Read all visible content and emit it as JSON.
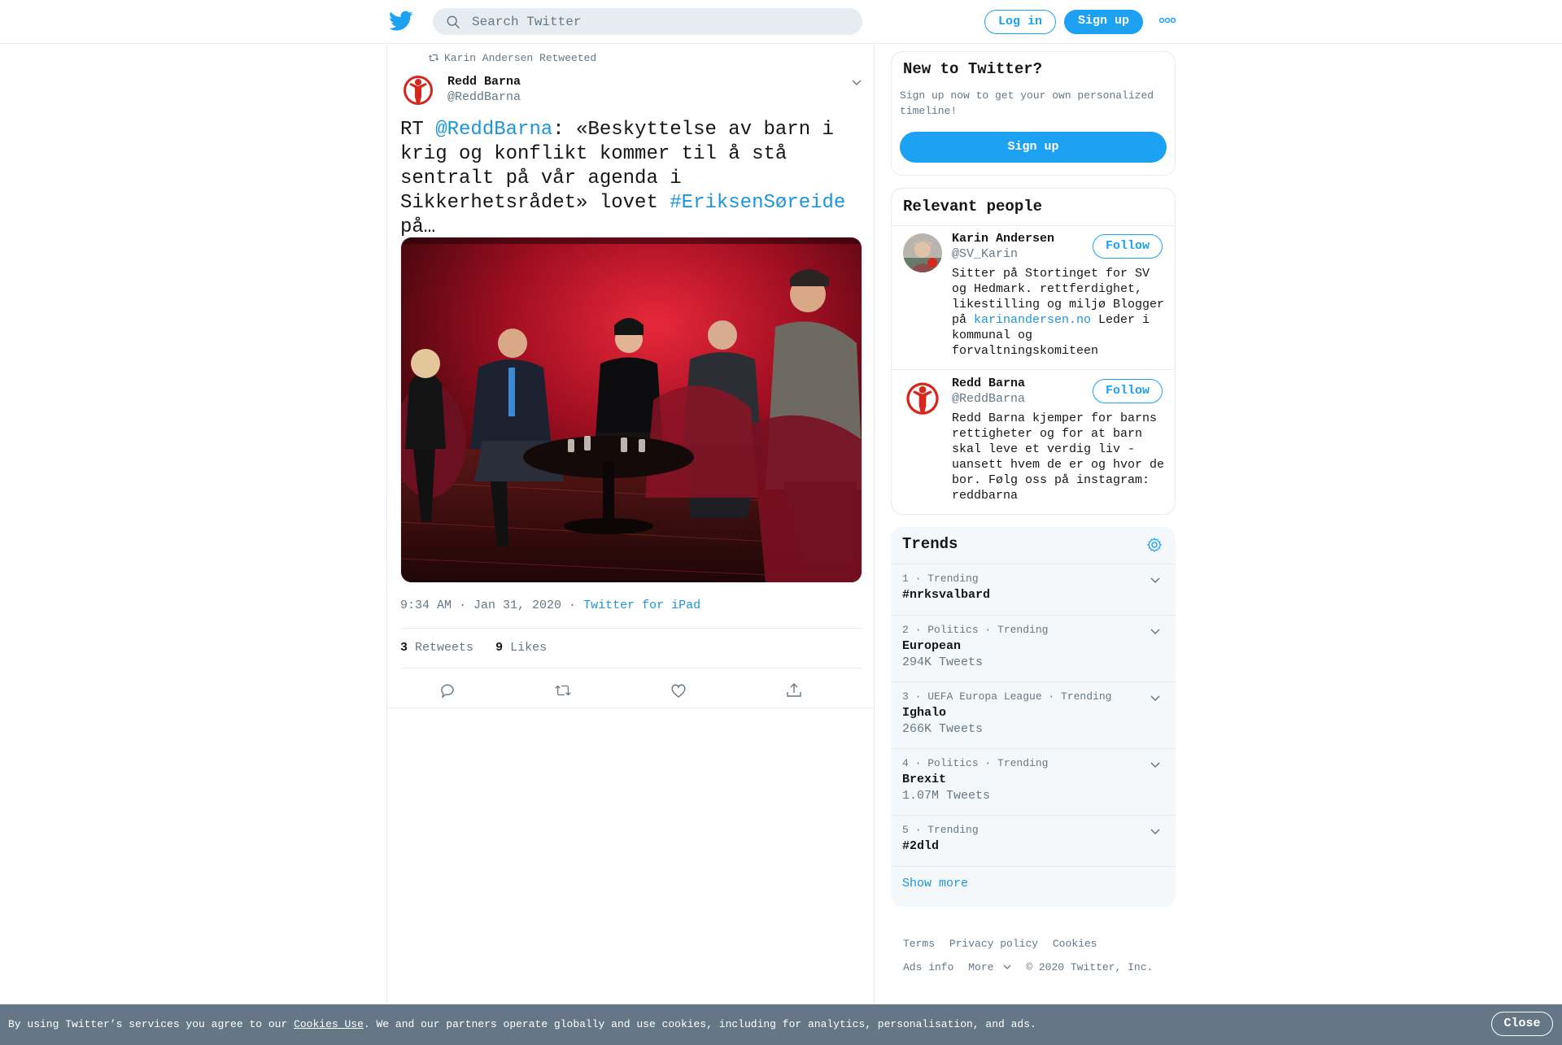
{
  "header": {
    "search_placeholder": "Search Twitter",
    "login_label": "Log in",
    "signup_label": "Sign up"
  },
  "tweet": {
    "retweeted_by": "Karin Andersen Retweeted",
    "author_name": "Redd Barna",
    "author_handle": "@ReddBarna",
    "text_parts": {
      "p1": "RT ",
      "mention": "@ReddBarna",
      "p2": ": «Beskyttelse av barn i krig og konflikt kommer til å stå sentralt på vår agenda i Sikkerhetsrådet» lovet ",
      "hashtag": "#EriksenSøreide",
      "p3": " på…"
    },
    "timestamp": "9:34 AM · Jan 31, 2020",
    "source_sep": " · ",
    "source": "Twitter for iPad",
    "retweets_count": "3",
    "retweets_label": "Retweets",
    "likes_count": "9",
    "likes_label": "Likes"
  },
  "new_to_twitter": {
    "title": "New to Twitter?",
    "description": "Sign up now to get your own personalized timeline!",
    "signup_label": "Sign up"
  },
  "relevant_people": {
    "title": "Relevant people",
    "people": [
      {
        "name": "Karin Andersen",
        "handle": "@SV_Karin",
        "follow_label": "Follow",
        "bio_a": "Sitter på Stortinget for SV og Hedmark. rettferdighet, likestilling og miljø Blogger på ",
        "bio_link": "karinandersen.no",
        "bio_b": " Leder i kommunal og forvaltningskomiteen"
      },
      {
        "name": "Redd Barna",
        "handle": "@ReddBarna",
        "follow_label": "Follow",
        "bio": "Redd Barna kjemper for barns rettigheter og for at barn skal leve et verdig liv - uansett hvem de er og hvor de bor. Følg oss på instagram: reddbarna"
      }
    ]
  },
  "trends": {
    "title": "Trends",
    "items": [
      {
        "meta": "1 · Trending",
        "name": "#nrksvalbard",
        "count": ""
      },
      {
        "meta": "2 · Politics · Trending",
        "name": "European",
        "count": "294K Tweets"
      },
      {
        "meta": "3 · UEFA Europa League · Trending",
        "name": "Ighalo",
        "count": "266K Tweets"
      },
      {
        "meta": "4 · Politics · Trending",
        "name": "Brexit",
        "count": "1.07M Tweets"
      },
      {
        "meta": "5 · Trending",
        "name": "#2dld",
        "count": ""
      }
    ],
    "show_more": "Show more"
  },
  "footer": {
    "terms": "Terms",
    "privacy": "Privacy policy",
    "cookies": "Cookies",
    "ads_info": "Ads info",
    "more": "More",
    "copyright": "© 2020 Twitter, Inc."
  },
  "cookie_bar": {
    "prefix": "By using Twitter’s services you agree to our ",
    "link": "Cookies Use",
    "suffix": ". We and our partners operate globally and use cookies, including for analytics, personalisation, and ads.",
    "close_label": "Close"
  },
  "colors": {
    "accent": "#1da1f2",
    "link": "#1b95e0",
    "secondary_text": "#657786",
    "border": "#e6ecf0",
    "cookie_bar": "#657786",
    "redd_barna_red": "#d7261e"
  },
  "icons": {
    "logo": "twitter-bird-icon",
    "search": "search-icon",
    "more": "more-dots-icon",
    "retweet": "retweet-icon",
    "caret": "chevron-down-icon",
    "reply": "reply-icon",
    "like": "heart-icon",
    "share": "share-icon",
    "settings": "gear-icon"
  }
}
